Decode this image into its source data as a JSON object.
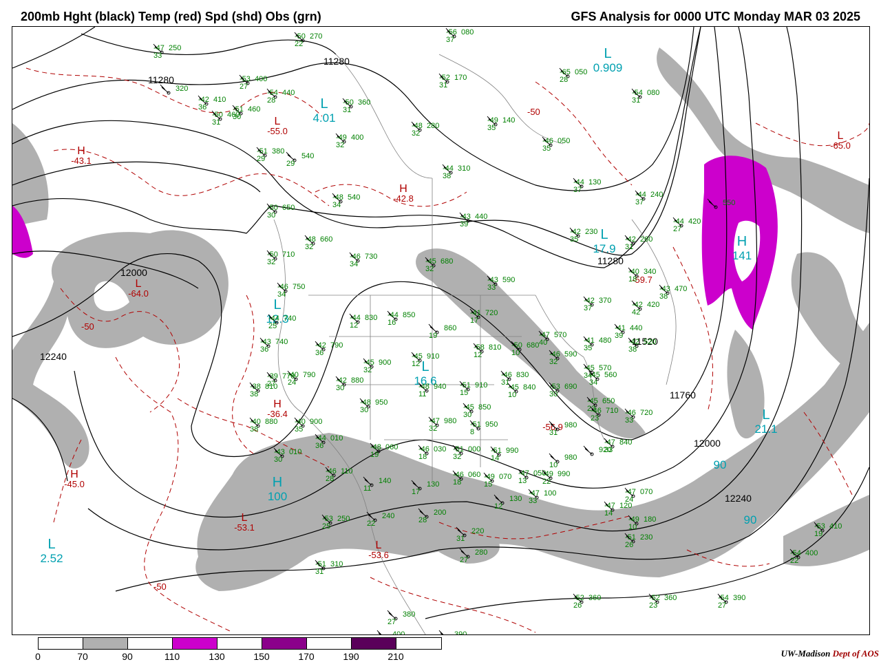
{
  "header": {
    "left_title": "200mb Hght (black) Temp (red) Spd (shd) Obs (grn)",
    "right_title": "GFS Analysis for 0000 UTC Monday  MAR 03 2025"
  },
  "colors": {
    "height_contour": "#000000",
    "temp_contour": "#b00000",
    "speed_70_90": "#b0b0b0",
    "speed_110_130": "#cc00cc",
    "speed_150_170": "#8b008b",
    "speed_190_210": "#5a005a",
    "obs": "#008000",
    "centers_cyan": "#00a0b0",
    "borders": "#808080"
  },
  "height_labels": [
    "11280",
    "11280",
    "11280",
    "11520",
    "11760",
    "12000",
    "12000",
    "12000",
    "12240",
    "12240"
  ],
  "temp_labels": [
    "-50",
    "-50",
    "-50",
    "-50"
  ],
  "centers": [
    {
      "letter": "H",
      "value": "-43.1",
      "kind": "temp"
    },
    {
      "letter": "H",
      "value": "-42.8",
      "kind": "temp"
    },
    {
      "letter": "L",
      "value": "-64.0",
      "kind": "temp"
    },
    {
      "letter": "H",
      "value": "-36.4",
      "kind": "temp"
    },
    {
      "letter": "H",
      "value": "-45.0",
      "kind": "temp"
    },
    {
      "letter": "L",
      "value": "-53.1",
      "kind": "temp"
    },
    {
      "letter": "L",
      "value": "-53.6",
      "kind": "temp"
    },
    {
      "letter": "L",
      "value": "-55.0",
      "kind": "temp"
    },
    {
      "letter": "L",
      "value": "-65.0",
      "kind": "temp"
    },
    {
      "letter": "L",
      "value": "-59.7",
      "kind": "temp"
    },
    {
      "letter": "L",
      "value": "-56.9",
      "kind": "temp"
    },
    {
      "letter": "L",
      "value": "0.909",
      "kind": "speed"
    },
    {
      "letter": "L",
      "value": "17.9",
      "kind": "speed"
    },
    {
      "letter": "H",
      "value": "141",
      "kind": "speed"
    },
    {
      "letter": "L",
      "value": "21.1",
      "kind": "speed"
    },
    {
      "letter": "H",
      "value": "100",
      "kind": "speed"
    },
    {
      "letter": "L",
      "value": "2.52",
      "kind": "speed"
    },
    {
      "letter": "L",
      "value": "4.01",
      "kind": "speed"
    },
    {
      "letter": "L",
      "value": "12.3",
      "kind": "speed"
    },
    {
      "letter": "L",
      "value": "16.6",
      "kind": "speed"
    },
    {
      "letter": "",
      "value": "90",
      "kind": "speed"
    },
    {
      "letter": "",
      "value": "90",
      "kind": "speed"
    }
  ],
  "observations": [
    {
      "t": "-47",
      "h": "250",
      "d": "33"
    },
    {
      "t": "-50",
      "h": "270",
      "d": "22"
    },
    {
      "t": "-56",
      "h": "080",
      "d": "37"
    },
    {
      "t": "-53",
      "h": "400",
      "d": "27"
    },
    {
      "t": "",
      "h": "320",
      "d": ""
    },
    {
      "t": "-42",
      "h": "410",
      "d": "36"
    },
    {
      "t": "-54",
      "h": "440",
      "d": "28"
    },
    {
      "t": "-51",
      "h": "460",
      "d": "30"
    },
    {
      "t": "-50",
      "h": "460",
      "d": "31"
    },
    {
      "t": "-50",
      "h": "360",
      "d": "31"
    },
    {
      "t": "-52",
      "h": "170",
      "d": "31"
    },
    {
      "t": "-65",
      "h": "050",
      "d": "28"
    },
    {
      "t": "-54",
      "h": "080",
      "d": "31"
    },
    {
      "t": "-48",
      "h": "280",
      "d": "32"
    },
    {
      "t": "-49",
      "h": "140",
      "d": "35"
    },
    {
      "t": "-46",
      "h": "050",
      "d": "35"
    },
    {
      "t": "-49",
      "h": "400",
      "d": "32"
    },
    {
      "t": "-51",
      "h": "380",
      "d": "29"
    },
    {
      "t": "",
      "h": "540",
      "d": "29"
    },
    {
      "t": "-44",
      "h": "310",
      "d": "38"
    },
    {
      "t": "-44",
      "h": "130",
      "d": "37"
    },
    {
      "t": "-48",
      "h": "540",
      "d": "34"
    },
    {
      "t": "-44",
      "h": "240",
      "d": "37"
    },
    {
      "t": "-50",
      "h": "650",
      "d": "30"
    },
    {
      "t": "-43",
      "h": "440",
      "d": "39"
    },
    {
      "t": "",
      "h": "550",
      "d": ""
    },
    {
      "t": "-44",
      "h": "420",
      "d": "27"
    },
    {
      "t": "-42",
      "h": "230",
      "d": "35"
    },
    {
      "t": "-42",
      "h": "260",
      "d": "31"
    },
    {
      "t": "-48",
      "h": "660",
      "d": "32"
    },
    {
      "t": "-46",
      "h": "730",
      "d": "34"
    },
    {
      "t": "-50",
      "h": "710",
      "d": "32"
    },
    {
      "t": "-45",
      "h": "680",
      "d": "32"
    },
    {
      "t": "-40",
      "h": "340",
      "d": "18"
    },
    {
      "t": "-43",
      "h": "590",
      "d": "33"
    },
    {
      "t": "-43",
      "h": "470",
      "d": "38"
    },
    {
      "t": "-46",
      "h": "750",
      "d": "34"
    },
    {
      "t": "-42",
      "h": "370",
      "d": "37"
    },
    {
      "t": "-42",
      "h": "420",
      "d": "42"
    },
    {
      "t": "-44",
      "h": "830",
      "d": "12"
    },
    {
      "t": "-44",
      "h": "850",
      "d": "16"
    },
    {
      "t": "-41",
      "h": "720",
      "d": "17"
    },
    {
      "t": "-44",
      "h": "740",
      "d": "25"
    },
    {
      "t": "",
      "h": "860",
      "d": "19"
    },
    {
      "t": "-41",
      "h": "440",
      "d": "39"
    },
    {
      "t": "-42",
      "h": "790",
      "d": "36"
    },
    {
      "t": "-47",
      "h": "570",
      "d": "40"
    },
    {
      "t": "-41",
      "h": "480",
      "d": "35"
    },
    {
      "t": "-42",
      "h": "520",
      "d": "38"
    },
    {
      "t": "-43",
      "h": "740",
      "d": "36"
    },
    {
      "t": "-58",
      "h": "810",
      "d": "12"
    },
    {
      "t": "-50",
      "h": "680",
      "d": "10"
    },
    {
      "t": "-46",
      "h": "590",
      "d": "32"
    },
    {
      "t": "-45",
      "h": "910",
      "d": "12"
    },
    {
      "t": "-45",
      "h": "900",
      "d": "32"
    },
    {
      "t": "-45",
      "h": "570",
      "d": "34"
    },
    {
      "t": "-45",
      "h": "560",
      "d": "34"
    },
    {
      "t": "-40",
      "h": "790",
      "d": "24"
    },
    {
      "t": "-39",
      "h": "770",
      "d": "27"
    },
    {
      "t": "-42",
      "h": "880",
      "d": "30"
    },
    {
      "t": "-46",
      "h": "830",
      "d": "31"
    },
    {
      "t": "-45",
      "h": "840",
      "d": "10"
    },
    {
      "t": "-53",
      "h": "690",
      "d": "30"
    },
    {
      "t": "-38",
      "h": "810",
      "d": "38"
    },
    {
      "t": "-48",
      "h": "940",
      "d": "11"
    },
    {
      "t": "-51",
      "h": "910",
      "d": "15"
    },
    {
      "t": "-48",
      "h": "950",
      "d": "30"
    },
    {
      "t": "-45",
      "h": "850",
      "d": "30"
    },
    {
      "t": "-45",
      "h": "650",
      "d": "23"
    },
    {
      "t": "-46",
      "h": "710",
      "d": "23"
    },
    {
      "t": "-46",
      "h": "720",
      "d": "33"
    },
    {
      "t": "-40",
      "h": "880",
      "d": "38"
    },
    {
      "t": "-40",
      "h": "900",
      "d": "35"
    },
    {
      "t": "-47",
      "h": "980",
      "d": "32"
    },
    {
      "t": "-51",
      "h": "950",
      "d": "8"
    },
    {
      "t": "",
      "h": "980",
      "d": "31"
    },
    {
      "t": "-47",
      "h": "840",
      "d": "33"
    },
    {
      "t": "-43",
      "h": "010",
      "d": "30"
    },
    {
      "t": "-44",
      "h": "010",
      "d": "36"
    },
    {
      "t": "-48",
      "h": "060",
      "d": "19"
    },
    {
      "t": "-46",
      "h": "030",
      "d": "18"
    },
    {
      "t": "-51",
      "h": "000",
      "d": "32"
    },
    {
      "t": "-51",
      "h": "990",
      "d": "14"
    },
    {
      "t": "",
      "h": "980",
      "d": "10"
    },
    {
      "t": "",
      "h": "920",
      "d": ""
    },
    {
      "t": "-46",
      "h": "110",
      "d": "28"
    },
    {
      "t": "-46",
      "h": "060",
      "d": "18"
    },
    {
      "t": "-49",
      "h": "070",
      "d": "15"
    },
    {
      "t": "-47",
      "h": "050",
      "d": "13"
    },
    {
      "t": "-49",
      "h": "990",
      "d": "22"
    },
    {
      "t": "",
      "h": "140",
      "d": "11"
    },
    {
      "t": "",
      "h": "130",
      "d": "17"
    },
    {
      "t": "-47",
      "h": "100",
      "d": "33"
    },
    {
      "t": "",
      "h": "130",
      "d": "12"
    },
    {
      "t": "-47",
      "h": "070",
      "d": "24"
    },
    {
      "t": "-47",
      "h": "120",
      "d": "14"
    },
    {
      "t": "-53",
      "h": "250",
      "d": "25"
    },
    {
      "t": "",
      "h": "240",
      "d": "22"
    },
    {
      "t": "",
      "h": "200",
      "d": "28"
    },
    {
      "t": "",
      "h": "220",
      "d": "31"
    },
    {
      "t": "-49",
      "h": "180",
      "d": "10"
    },
    {
      "t": "-51",
      "h": "230",
      "d": "26"
    },
    {
      "t": "-53",
      "h": "410",
      "d": "19"
    },
    {
      "t": "-51",
      "h": "310",
      "d": "31"
    },
    {
      "t": "",
      "h": "280",
      "d": "27"
    },
    {
      "t": "-54",
      "h": "400",
      "d": "22"
    },
    {
      "t": "-52",
      "h": "360",
      "d": "26"
    },
    {
      "t": "-52",
      "h": "360",
      "d": "23"
    },
    {
      "t": "-54",
      "h": "390",
      "d": "27"
    },
    {
      "t": "",
      "h": "380",
      "d": "27"
    },
    {
      "t": "",
      "h": "400",
      "d": "33"
    },
    {
      "t": "",
      "h": "390",
      "d": ""
    }
  ],
  "legend": {
    "ticks": [
      "0",
      "70",
      "90",
      "110",
      "130",
      "150",
      "170",
      "190",
      "210"
    ]
  },
  "footer": {
    "credit": "UW-Madison",
    "dept": "Dept of AOS"
  }
}
